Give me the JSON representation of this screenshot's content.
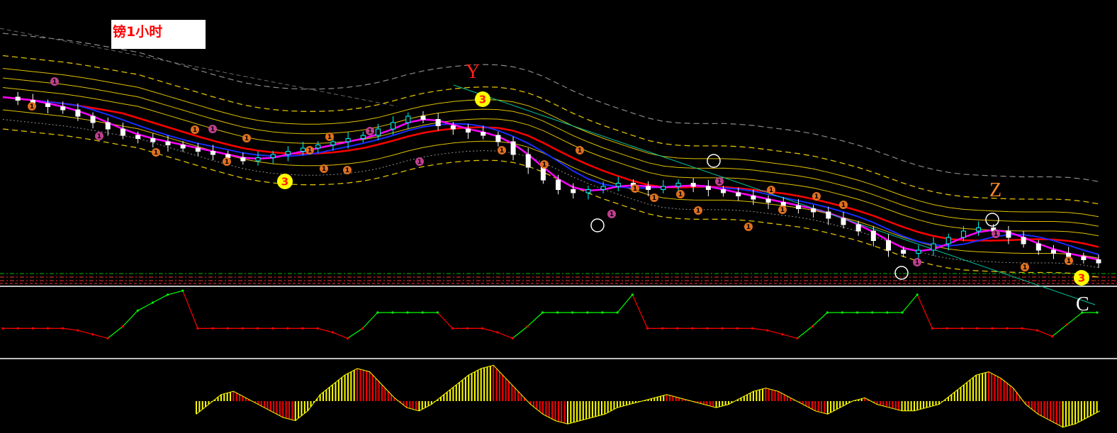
{
  "title": "镑1小时",
  "wave_labels": [
    {
      "text": "Y",
      "color": "#ff2020"
    },
    {
      "text": "Z",
      "color": "#ff8a2a"
    },
    {
      "text": "C",
      "color": "#ffffff"
    }
  ],
  "markers": {
    "yellow_badge_text": "3",
    "small_badge_text": "1"
  },
  "colors": {
    "background": "#000000",
    "candle_up": "#00ffff",
    "candle_down": "#ffffff",
    "ma_red": "#ff0000",
    "ma_magenta": "#ff00ff",
    "ma_blue": "#1a2cff",
    "band_yellow": "#e0c000",
    "trendline": "#00c8a0",
    "osc_up": "#00ff00",
    "osc_down": "#ff0000",
    "hist_up": "#ffff00",
    "hist_down": "#ff0000"
  },
  "chart_data": [
    {
      "type": "candlestick",
      "title": "镑1小时",
      "close": [
        1.316,
        1.315,
        1.314,
        1.313,
        1.312,
        1.31,
        1.308,
        1.306,
        1.304,
        1.303,
        1.302,
        1.301,
        1.3,
        1.299,
        1.298,
        1.297,
        1.296,
        1.297,
        1.298,
        1.299,
        1.3,
        1.301,
        1.302,
        1.303,
        1.304,
        1.306,
        1.308,
        1.31,
        1.309,
        1.307,
        1.306,
        1.305,
        1.304,
        1.302,
        1.298,
        1.294,
        1.29,
        1.287,
        1.286,
        1.287,
        1.288,
        1.289,
        1.288,
        1.287,
        1.288,
        1.289,
        1.288,
        1.287,
        1.286,
        1.285,
        1.284,
        1.283,
        1.282,
        1.281,
        1.28,
        1.278,
        1.276,
        1.274,
        1.271,
        1.268,
        1.267,
        1.268,
        1.27,
        1.272,
        1.274,
        1.275,
        1.274,
        1.272,
        1.27,
        1.268,
        1.267,
        1.266,
        1.265,
        1.264
      ]
    },
    {
      "type": "line",
      "series": [
        {
          "values": [
            -3,
            -3,
            -3,
            -3,
            -3,
            -4,
            -6,
            -8,
            -2,
            6,
            10,
            14,
            16,
            -3,
            -3,
            -3,
            -3,
            -3,
            -3,
            -3,
            -3,
            -3,
            -5,
            -8,
            -3,
            5,
            5,
            5,
            5,
            5,
            -3,
            -3,
            -3,
            -5,
            -8,
            -2,
            5,
            5,
            5,
            5,
            5,
            5,
            14,
            -3,
            -3,
            -3,
            -3,
            -3,
            -3,
            -3,
            -3,
            -4,
            -6,
            -8,
            -2,
            5,
            5,
            5,
            5,
            5,
            5,
            14,
            -3,
            -3,
            -3,
            -3,
            -3,
            -3,
            -3,
            -4,
            -7,
            -1,
            5,
            5
          ]
        }
      ]
    },
    {
      "type": "bar",
      "series": [
        {
          "values": [
            -8,
            -2,
            4,
            6,
            2,
            -2,
            -6,
            -10,
            -12,
            -6,
            4,
            10,
            16,
            20,
            18,
            10,
            2,
            -4,
            -6,
            -2,
            4,
            10,
            16,
            20,
            22,
            14,
            6,
            -2,
            -8,
            -12,
            -14,
            -12,
            -10,
            -8,
            -4,
            -2,
            0,
            2,
            4,
            2,
            0,
            -2,
            -4,
            -2,
            2,
            6,
            8,
            6,
            2,
            -2,
            -6,
            -8,
            -4,
            0,
            2,
            -2,
            -4,
            -6,
            -6,
            -4,
            -2,
            4,
            10,
            16,
            18,
            14,
            8,
            -2,
            -8,
            -12,
            -16,
            -14,
            -10,
            -6
          ]
        }
      ]
    }
  ]
}
